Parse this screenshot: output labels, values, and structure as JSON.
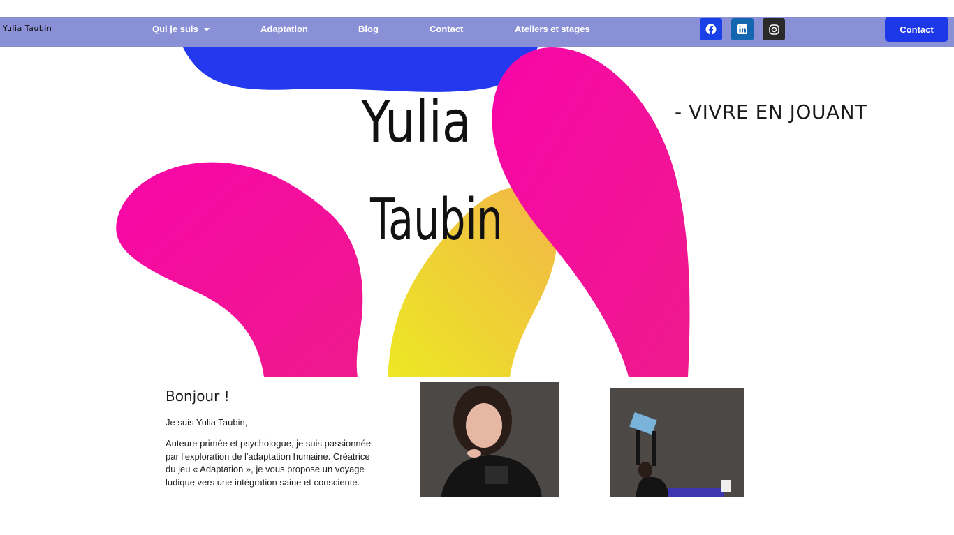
{
  "header": {
    "logo_text": "Yulia Taubin",
    "nav": [
      {
        "label": "Qui je suis",
        "has_dropdown": true
      },
      {
        "label": "Adaptation"
      },
      {
        "label": "Blog"
      },
      {
        "label": "Contact"
      },
      {
        "label": "Ateliers et stages"
      }
    ],
    "socials": [
      {
        "icon": "facebook-icon",
        "color": "#1a40e8"
      },
      {
        "icon": "linkedin-icon",
        "color": "#1466b0"
      },
      {
        "icon": "instagram-icon",
        "color": "#2a2a2a"
      }
    ],
    "cta_label": "Contact"
  },
  "hero": {
    "name_line1": "Yulia",
    "name_line2": "Taubin",
    "tagline": "- VIVRE EN JOUANT",
    "colors": {
      "blue": "#2438ee",
      "pink": "#f20a9a",
      "yellow": "#ece824"
    }
  },
  "intro": {
    "title": "Bonjour !",
    "line": "Je suis Yulia Taubin,",
    "paragraph": "Auteure primée et psychologue, je suis passionnée par l'exploration de l'adaptation humaine. Créatrice du jeu « Adaptation », je vous propose un voyage ludique vers une intégration saine et consciente."
  },
  "photos": [
    {
      "name": "portrait-photo"
    },
    {
      "name": "game-board-photo"
    }
  ],
  "colors": {
    "nav_bg": "#8a90d6",
    "cta_bg": "#1d38e6"
  }
}
